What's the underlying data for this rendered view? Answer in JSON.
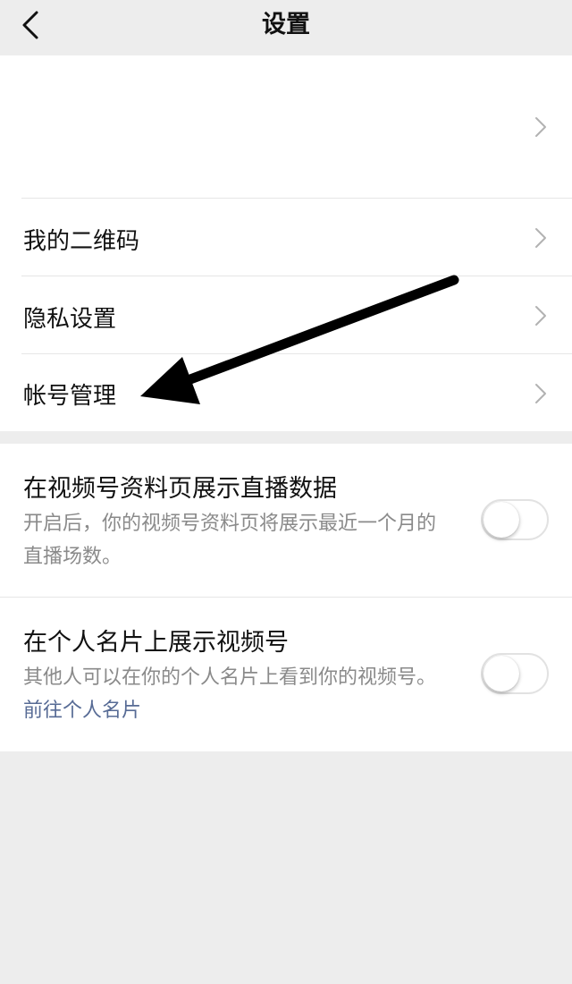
{
  "nav": {
    "title": "设置",
    "back_icon": "chevron-left-icon"
  },
  "settings_rows": [
    {
      "label": ""
    },
    {
      "label": "我的二维码"
    },
    {
      "label": "隐私设置"
    },
    {
      "label": "帐号管理"
    }
  ],
  "toggles": [
    {
      "title": "在视频号资料页展示直播数据",
      "description": "开启后，你的视频号资料页将展示最近一个月的直播场数。",
      "enabled": false
    },
    {
      "title": "在个人名片上展示视频号",
      "description": "其他人可以在你的个人名片上看到你的视频号。",
      "link": "前往个人名片",
      "enabled": false
    }
  ],
  "colors": {
    "background": "#ededed",
    "card": "#ffffff",
    "link": "#576b95",
    "secondary_text": "#8a8a8a",
    "annotation_arrow": "#000000"
  }
}
